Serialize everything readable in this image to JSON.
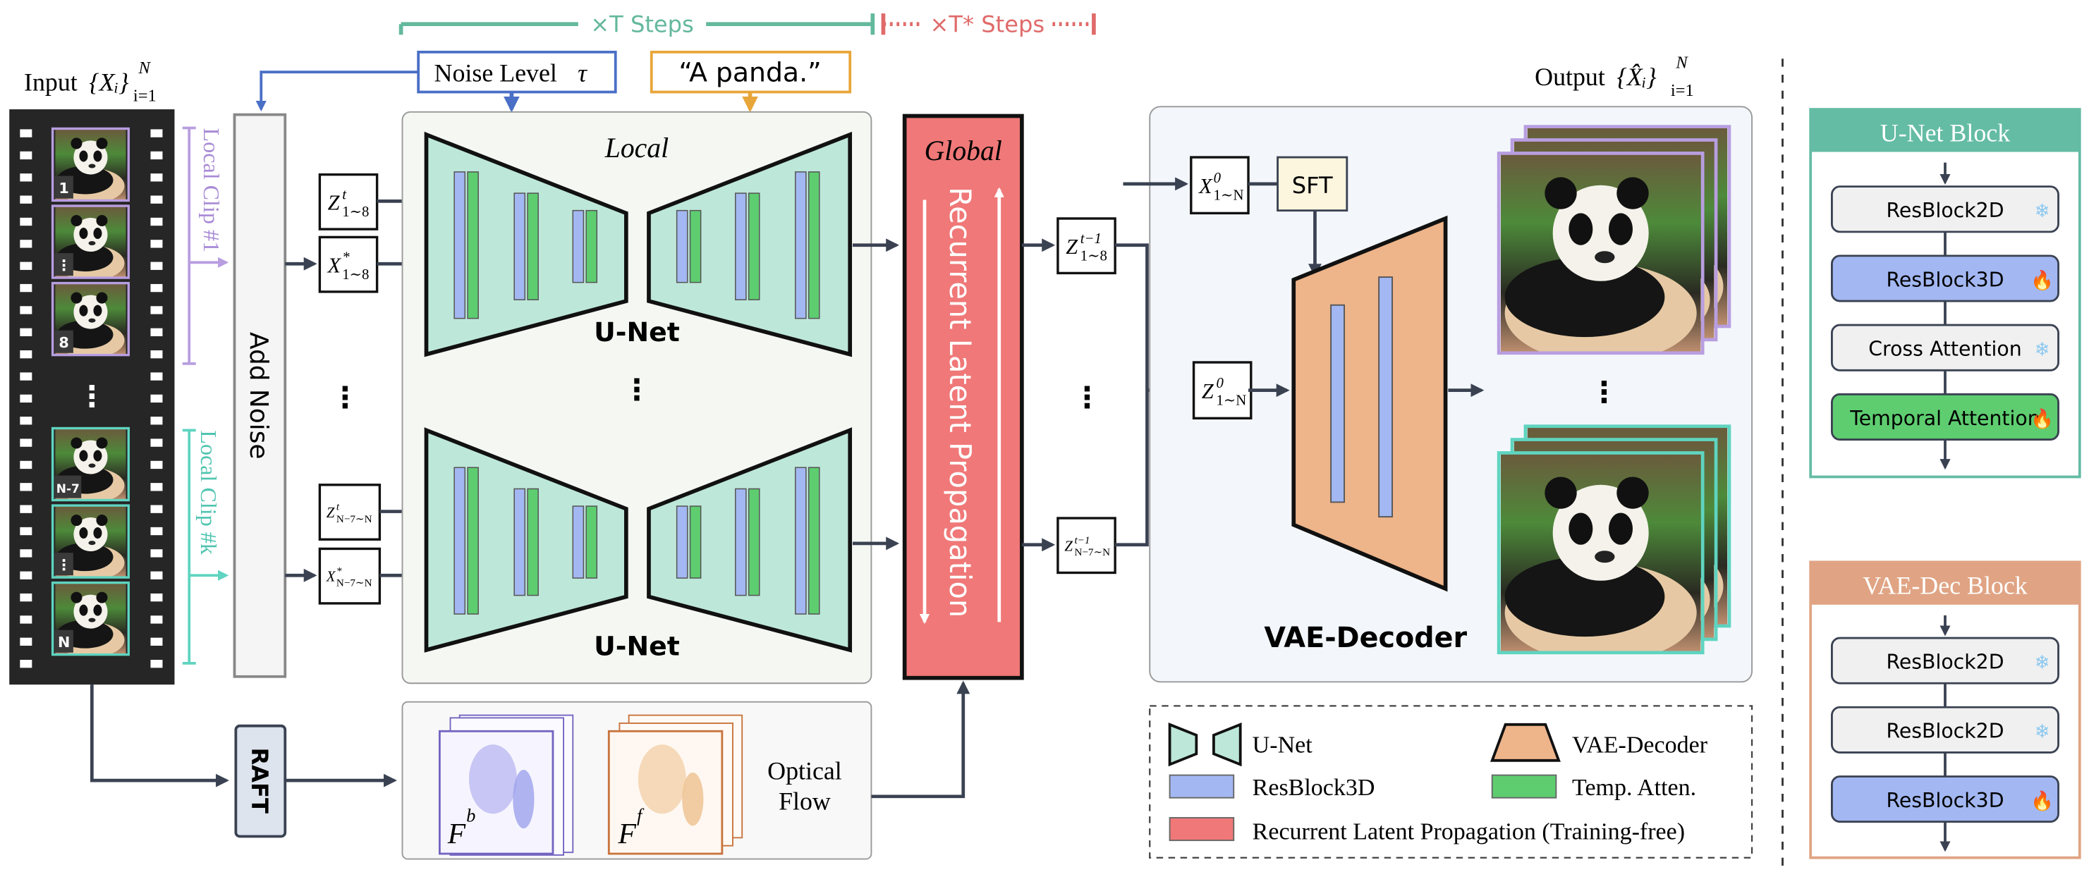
{
  "colors": {
    "unet_fill": "#bde7d9",
    "resblock3d": "#a3b8f2",
    "temp_atten": "#5ecd70",
    "rlp_fill": "#f07878",
    "vae_fill": "#eeb48a",
    "steps_green": "#64b89d",
    "steps_red": "#e06a6a",
    "noise_blue": "#4a6fc6",
    "prompt_orange": "#e8a63a",
    "clip1_purple": "#b89ee0",
    "clipk_teal": "#5fd4c0",
    "arrow": "#3a4252",
    "unet_block_header": "#64bca4",
    "vae_block_header": "#e0a484",
    "sft_fill": "#fdf6de",
    "raft_fill": "#dde4ee"
  },
  "top": {
    "t_steps": "×T Steps",
    "t_star_steps": "×T* Steps"
  },
  "noise_level": {
    "label": "Noise Level",
    "symbol": "τ"
  },
  "prompt": {
    "label": "“A panda.”"
  },
  "input": {
    "title": "Input",
    "math": "{Xᵢ}",
    "sup": "N",
    "sub": "i=1"
  },
  "output": {
    "title": "Output",
    "math": "{X̂ᵢ}",
    "sup": "N",
    "sub": "i=1"
  },
  "filmstrip": {
    "frames": [
      {
        "badge": "1",
        "clip": "1"
      },
      {
        "badge": "⋮",
        "clip": "1"
      },
      {
        "badge": "8",
        "clip": "1"
      },
      {
        "badge": "N-7",
        "clip": "k"
      },
      {
        "badge": "⋮",
        "clip": "k"
      },
      {
        "badge": "N",
        "clip": "k"
      }
    ],
    "ellipsis": "⋮"
  },
  "clips": {
    "clip1": "Local Clip #1",
    "clipk": "Local Clip #k"
  },
  "add_noise": "Add Noise",
  "latents": {
    "z1": {
      "base": "Z",
      "sup": "t",
      "sub": "1∼8"
    },
    "x1": {
      "base": "X",
      "sup": "*",
      "sub": "1∼8"
    },
    "zk": {
      "base": "Z",
      "sup": "t",
      "sub": "N−7∼N"
    },
    "xk": {
      "base": "X",
      "sup": "*",
      "sub": "N−7∼N"
    },
    "ellipsis": "⋮"
  },
  "local_panel": {
    "title": "Local",
    "unet_label": "U-Net",
    "ellipsis": "⋮"
  },
  "global_panel": {
    "title": "Global",
    "label": "Recurrent Latent Propagation"
  },
  "outputs_latent": {
    "z1": {
      "base": "Z",
      "sup": "t−1",
      "sub": "1∼8"
    },
    "zk": {
      "base": "Z",
      "sup": "t−1",
      "sub": "N−7∼N"
    },
    "ellipsis": "⋮"
  },
  "vae_panel": {
    "x0": {
      "base": "X",
      "sup": "0",
      "sub": "1∼N"
    },
    "z0": {
      "base": "Z",
      "sup": "0",
      "sub": "1∼N"
    },
    "sft": "SFT",
    "label": "VAE-Decoder",
    "ellipsis": "⋮"
  },
  "raft": "RAFT",
  "flow": {
    "fb": "F",
    "fb_sup": "b",
    "ff": "F",
    "ff_sup": "f",
    "label_line1": "Optical",
    "label_line2": "Flow"
  },
  "legend": [
    {
      "icon": "unet-shape",
      "label": "U-Net"
    },
    {
      "icon": "vae-shape",
      "label": "VAE-Decoder"
    },
    {
      "icon": "resblock3d-swatch",
      "label": "ResBlock3D"
    },
    {
      "icon": "temp-atten-swatch",
      "label": "Temp. Atten."
    },
    {
      "icon": "rlp-swatch",
      "label": "Recurrent Latent Propagation (Training-free)"
    }
  ],
  "unet_block": {
    "title": "U-Net Block",
    "layers": [
      {
        "label": "ResBlock2D",
        "state": "frozen",
        "icon": "❄"
      },
      {
        "label": "ResBlock3D",
        "state": "trainable",
        "icon": "🔥"
      },
      {
        "label": "Cross Attention",
        "state": "frozen",
        "icon": "❄"
      },
      {
        "label": "Temporal Attention",
        "state": "trainable",
        "icon": "🔥"
      }
    ]
  },
  "vae_block": {
    "title": "VAE-Dec Block",
    "layers": [
      {
        "label": "ResBlock2D",
        "state": "frozen",
        "icon": "❄"
      },
      {
        "label": "ResBlock2D",
        "state": "frozen",
        "icon": "❄"
      },
      {
        "label": "ResBlock3D",
        "state": "trainable",
        "icon": "🔥"
      }
    ]
  }
}
